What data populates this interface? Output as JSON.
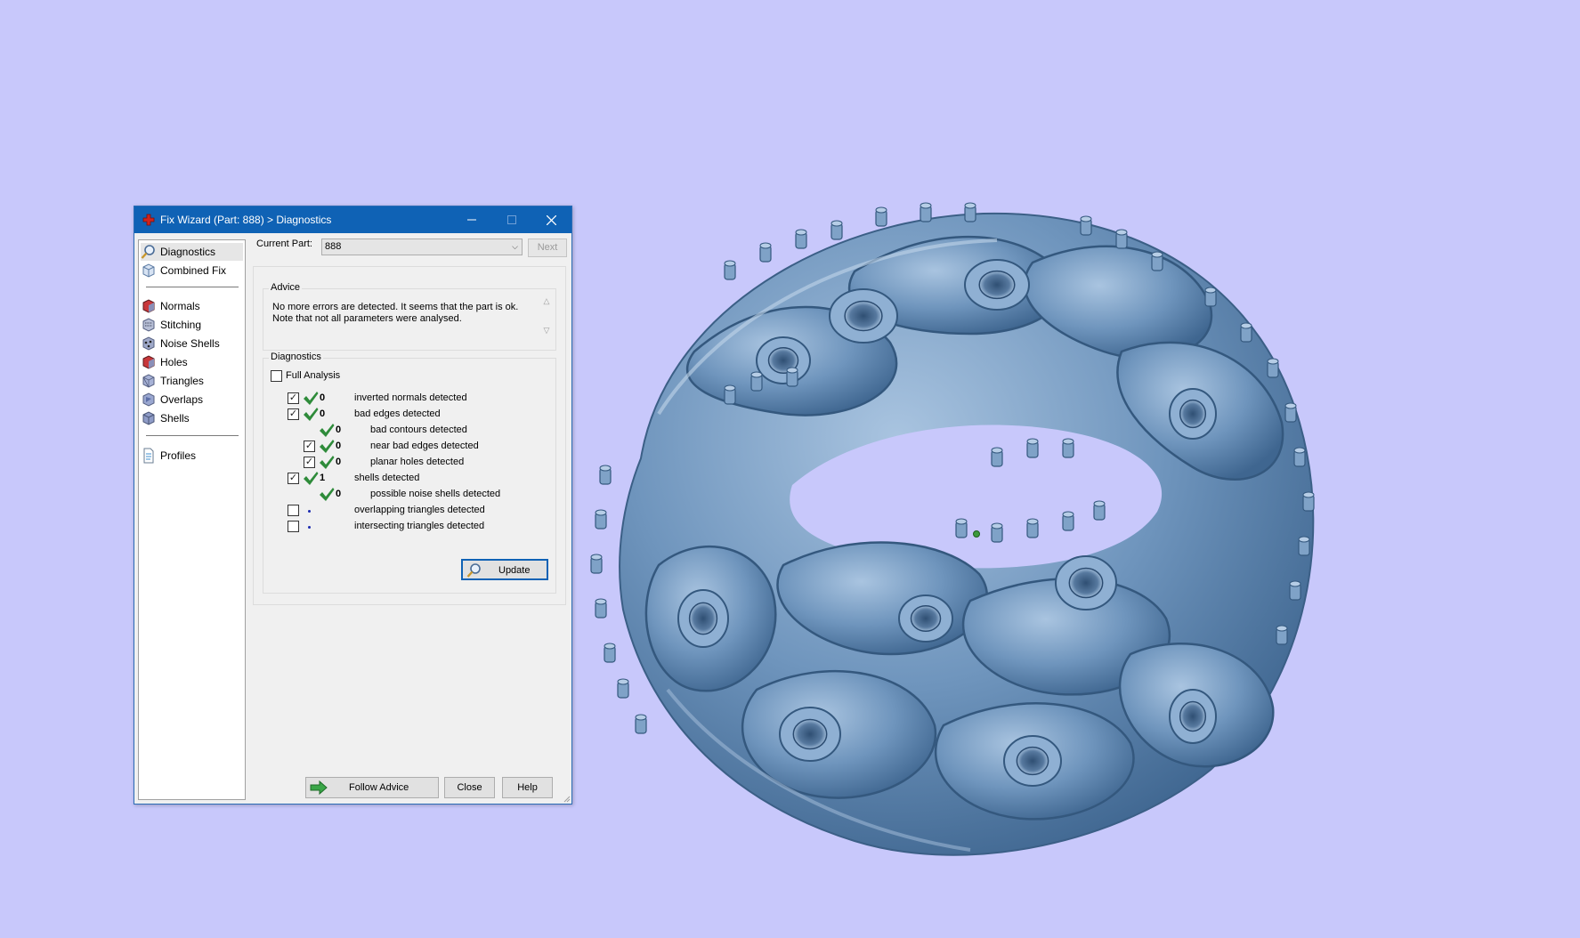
{
  "colors": {
    "background": "#c8c8fb",
    "model": "#6f95bd",
    "titlebar": "#0f62b5",
    "check_green": "#2e8b3a"
  },
  "window": {
    "title": "Fix Wizard (Part: 888) > Diagnostics",
    "app_icon": "red-cross-icon",
    "controls": [
      "minimize",
      "maximize",
      "close"
    ]
  },
  "nav": {
    "top": [
      {
        "label": "Diagnostics",
        "icon": "magnifier-icon",
        "selected": true
      },
      {
        "label": "Combined Fix",
        "icon": "cube-icon",
        "selected": false
      }
    ],
    "fixes": [
      {
        "label": "Normals",
        "icon": "normals-cube-icon"
      },
      {
        "label": "Stitching",
        "icon": "stitching-cube-icon"
      },
      {
        "label": "Noise Shells",
        "icon": "noise-shells-icon"
      },
      {
        "label": "Holes",
        "icon": "holes-cube-icon"
      },
      {
        "label": "Triangles",
        "icon": "triangles-cube-icon"
      },
      {
        "label": "Overlaps",
        "icon": "overlaps-cube-icon"
      },
      {
        "label": "Shells",
        "icon": "shells-cube-icon"
      }
    ],
    "bottom": [
      {
        "label": "Profiles",
        "icon": "document-icon"
      }
    ]
  },
  "current_part": {
    "label": "Current Part:",
    "value": "888",
    "next_label": "Next"
  },
  "advice": {
    "title": "Advice",
    "text": "No more errors are detected. It seems that the part is ok. Note that not all parameters were analysed."
  },
  "diagnostics": {
    "title": "Diagnostics",
    "full_analysis_label": "Full Analysis",
    "full_analysis_checked": false,
    "rows": [
      {
        "label": "inverted normals detected",
        "count": "0",
        "checkbox": true,
        "checked": true,
        "ok": true
      },
      {
        "label": "bad edges detected",
        "count": "0",
        "checkbox": true,
        "checked": true,
        "ok": true
      },
      {
        "label": "bad contours detected",
        "count": "0",
        "checkbox": false,
        "checked": false,
        "ok": true
      },
      {
        "label": "near bad edges detected",
        "count": "0",
        "checkbox": true,
        "checked": true,
        "ok": true
      },
      {
        "label": "planar holes detected",
        "count": "0",
        "checkbox": true,
        "checked": true,
        "ok": true
      },
      {
        "label": "shells detected",
        "count": "1",
        "checkbox": true,
        "checked": true,
        "ok": true
      },
      {
        "label": "possible noise shells detected",
        "count": "0",
        "checkbox": false,
        "checked": false,
        "ok": true
      },
      {
        "label": "overlapping triangles detected",
        "count": "",
        "checkbox": true,
        "checked": false,
        "ok": false
      },
      {
        "label": "intersecting triangles detected",
        "count": "",
        "checkbox": true,
        "checked": false,
        "ok": false
      }
    ],
    "update_label": "Update"
  },
  "buttons": {
    "follow_advice": "Follow Advice",
    "close": "Close",
    "help": "Help"
  }
}
